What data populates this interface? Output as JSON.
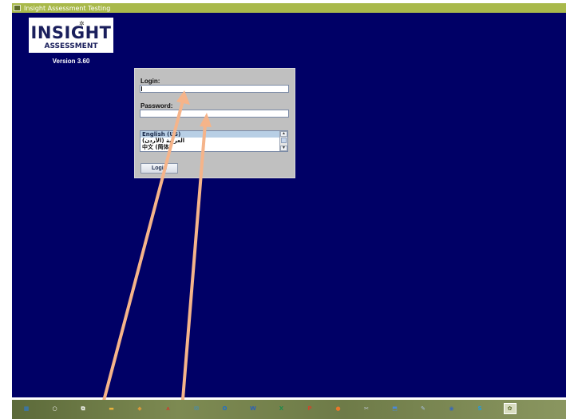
{
  "window": {
    "title": "Insight Assessment Testing",
    "title_bar_color": "#a9b94b",
    "background_color": "#000066"
  },
  "branding": {
    "logo_word": "INSIGHT",
    "logo_subtitle": "ASSESSMENT",
    "version": "Version 3.60"
  },
  "login_form": {
    "login_label": "Login:",
    "login_value": "",
    "password_label": "Password:",
    "password_value": "",
    "languages": [
      {
        "label": "English (US)",
        "selected": true
      },
      {
        "label": "العربية (الأردن)",
        "selected": false
      },
      {
        "label": "中文 (简体)",
        "selected": false
      }
    ],
    "login_button_label": "Login",
    "panel_color": "#c0c0c0"
  },
  "annotations": {
    "arrow_color": "#f5b48a",
    "arrow_targets": [
      "login-field",
      "password-field"
    ]
  },
  "taskbar": {
    "items": [
      {
        "name": "start-icon",
        "glyph": "▦",
        "color": "#2b7bd8"
      },
      {
        "name": "cortana-icon",
        "glyph": "○",
        "color": "#ffffff"
      },
      {
        "name": "task-view-icon",
        "glyph": "⧉",
        "color": "#ffffff"
      },
      {
        "name": "file-explorer-icon",
        "glyph": "▬",
        "color": "#e8b23c"
      },
      {
        "name": "paint-icon",
        "glyph": "◆",
        "color": "#d89a3a"
      },
      {
        "name": "acrobat-icon",
        "glyph": "⋏",
        "color": "#d8322a"
      },
      {
        "name": "mail-icon",
        "glyph": "✉",
        "color": "#2f8fd8"
      },
      {
        "name": "outlook-icon",
        "glyph": "O",
        "color": "#1f6fc8"
      },
      {
        "name": "word-icon",
        "glyph": "W",
        "color": "#2b5fb8"
      },
      {
        "name": "excel-icon",
        "glyph": "X",
        "color": "#1f8a4a"
      },
      {
        "name": "powerpoint-icon",
        "glyph": "P",
        "color": "#d0452a"
      },
      {
        "name": "firefox-icon",
        "glyph": "●",
        "color": "#e8782a"
      },
      {
        "name": "snipping-tool-icon",
        "glyph": "✂",
        "color": "#c8d0e0"
      },
      {
        "name": "network-icon",
        "glyph": "⬒",
        "color": "#4a8ad8"
      },
      {
        "name": "paint-brush-icon",
        "glyph": "✎",
        "color": "#a8c0e0"
      },
      {
        "name": "camera-icon",
        "glyph": "◉",
        "color": "#3a6ab8"
      },
      {
        "name": "skype-icon",
        "glyph": "S",
        "color": "#1f9fe8"
      },
      {
        "name": "insight-app-icon",
        "glyph": "✿",
        "color": "#5c6a2a"
      }
    ]
  }
}
